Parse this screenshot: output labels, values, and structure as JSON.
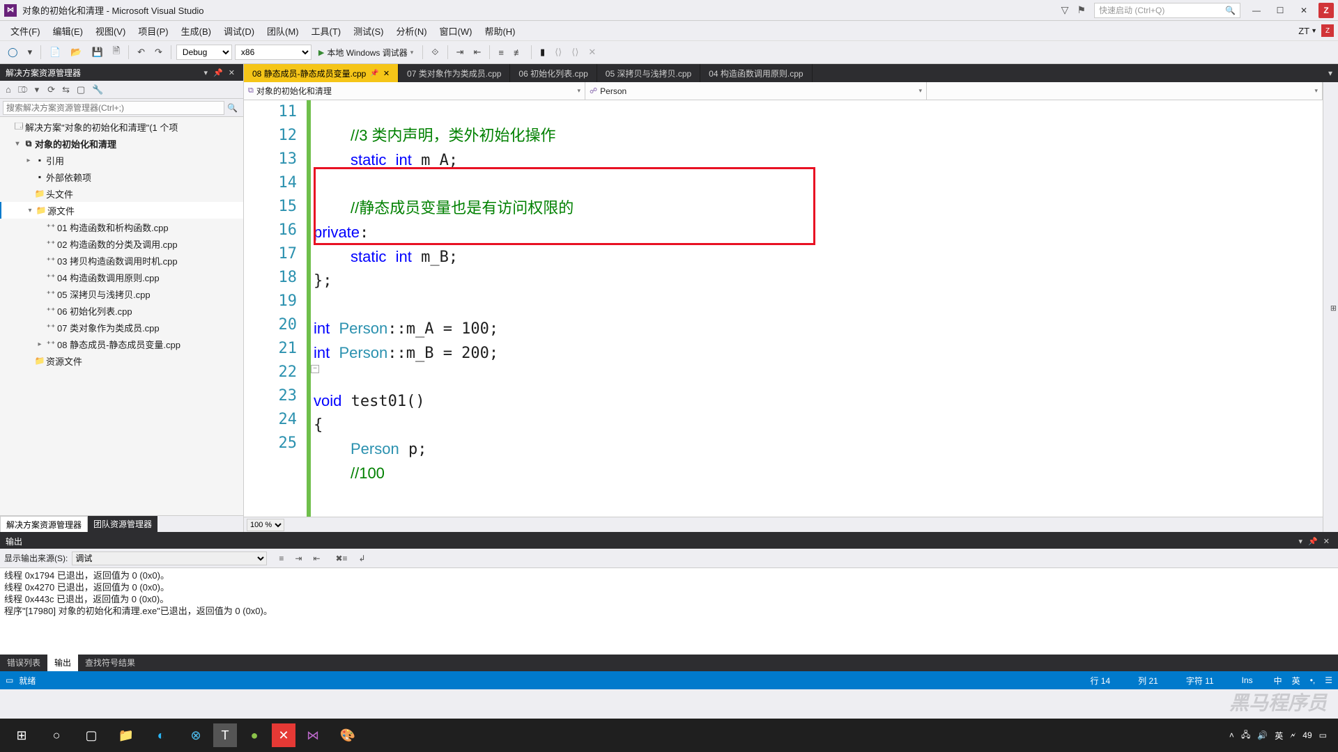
{
  "titlebar": {
    "title": "对象的初始化和清理 - Microsoft Visual Studio",
    "quick_launch_placeholder": "快速启动 (Ctrl+Q)",
    "zbadge": "Z"
  },
  "menu": {
    "items": [
      "文件(F)",
      "编辑(E)",
      "视图(V)",
      "项目(P)",
      "生成(B)",
      "调试(D)",
      "团队(M)",
      "工具(T)",
      "测试(S)",
      "分析(N)",
      "窗口(W)",
      "帮助(H)"
    ],
    "right_label": "ZT"
  },
  "toolbar": {
    "config": "Debug",
    "platform": "x86",
    "debug_button": "本地 Windows 调试器"
  },
  "solution_explorer": {
    "title": "解决方案资源管理器",
    "search_placeholder": "搜索解决方案资源管理器(Ctrl+;)",
    "solution_line": "解决方案\"对象的初始化和清理\"(1 个项",
    "project": "对象的初始化和清理",
    "folders": {
      "refs": "引用",
      "ext": "外部依赖项",
      "headers": "头文件",
      "sources": "源文件",
      "resources": "资源文件"
    },
    "source_files": [
      "01 构造函数和析构函数.cpp",
      "02 构造函数的分类及调用.cpp",
      "03 拷贝构造函数调用时机.cpp",
      "04 构造函数调用原则.cpp",
      "05 深拷贝与浅拷贝.cpp",
      "06 初始化列表.cpp",
      "07 类对象作为类成员.cpp",
      "08 静态成员-静态成员变量.cpp"
    ],
    "tabs": {
      "active": "解决方案资源管理器",
      "other": "团队资源管理器"
    }
  },
  "editor": {
    "tabs": [
      {
        "label": "08 静态成员-静态成员变量.cpp",
        "active": true,
        "pinned": true
      },
      {
        "label": "07 类对象作为类成员.cpp",
        "active": false
      },
      {
        "label": "06 初始化列表.cpp",
        "active": false
      },
      {
        "label": "05 深拷贝与浅拷贝.cpp",
        "active": false
      },
      {
        "label": "04 构造函数调用原则.cpp",
        "active": false
      }
    ],
    "nav_left": "对象的初始化和清理",
    "nav_right": "Person",
    "zoom": "100 %",
    "lines": {
      "11": "        //3 类内声明，类外初始化操作",
      "12": "        static int m_A;",
      "13": "",
      "14": "        //静态成员变量也是有访问权限的",
      "15": "    private:",
      "16": "        static int m_B;",
      "17": "    };",
      "18": "",
      "19": "    int Person::m_A = 100;",
      "20": "    int Person::m_B = 200;",
      "21": "",
      "22": "   ⊟void test01()",
      "23": "    {",
      "24": "        Person p;",
      "25": "        //100"
    }
  },
  "output": {
    "title": "输出",
    "source_label": "显示输出来源(S):",
    "source_value": "调试",
    "lines": [
      "线程 0x1794 已退出，返回值为 0 (0x0)。",
      "线程 0x4270 已退出，返回值为 0 (0x0)。",
      "线程 0x443c 已退出，返回值为 0 (0x0)。",
      "程序\"[17980] 对象的初始化和清理.exe\"已退出，返回值为 0 (0x0)。"
    ],
    "tabs": [
      "错误列表",
      "输出",
      "查找符号结果"
    ],
    "active_tab": "输出"
  },
  "status": {
    "ready": "就绪",
    "line_label": "行 14",
    "col_label": "列 21",
    "char_label": "字符 11",
    "ins": "Ins"
  },
  "taskbar": {
    "time": "49",
    "ime": "英",
    "watermark": "黑马程序员"
  }
}
